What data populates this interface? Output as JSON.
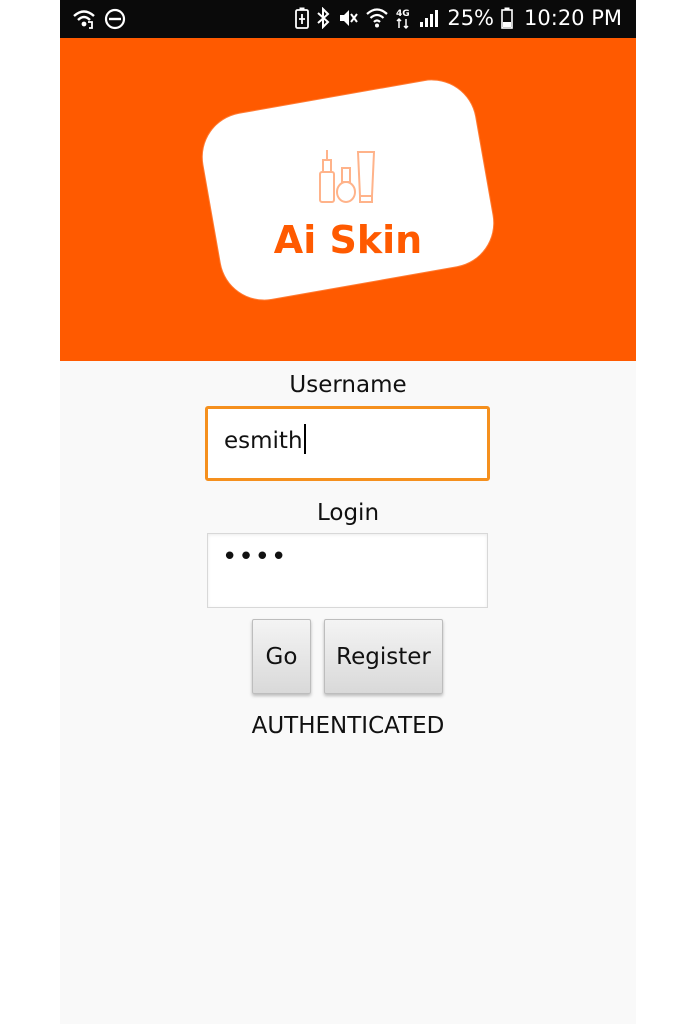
{
  "status_bar": {
    "battery_percent": "25%",
    "time": "10:20 PM",
    "network": "4G",
    "icons": [
      "wifi-calling-icon",
      "do-not-disturb-icon",
      "battery-saver-icon",
      "bluetooth-icon",
      "mute-icon",
      "wifi-icon",
      "4g-data-icon",
      "signal-icon",
      "battery-icon"
    ]
  },
  "header": {
    "background_color": "#ff5a00",
    "logo_text": "Ai Skin"
  },
  "form": {
    "username_label": "Username",
    "username_value": "esmith",
    "login_label": "Login",
    "password_masked": "••••",
    "go_button": "Go",
    "register_button": "Register",
    "status_message": "AUTHENTICATED"
  },
  "colors": {
    "accent": "#ff5a00",
    "focus_border": "#f5901e"
  }
}
